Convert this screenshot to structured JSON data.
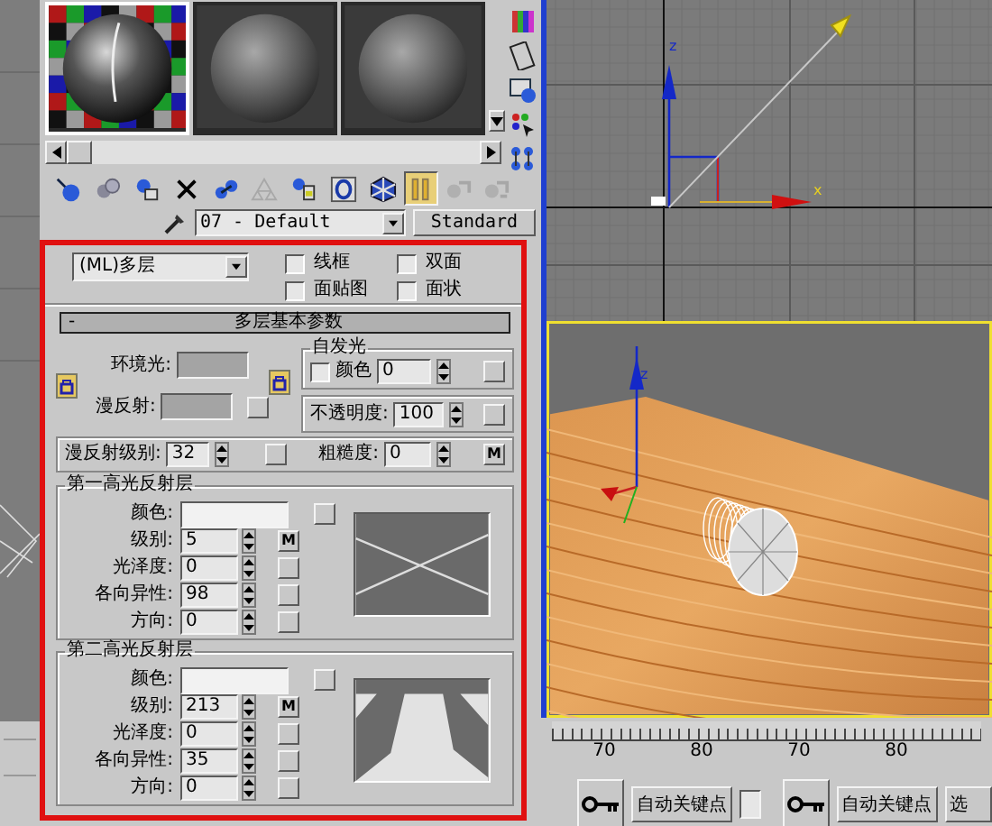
{
  "sample_slots": [
    {
      "selected": true,
      "checker_background": true
    },
    {
      "selected": false,
      "checker_background": false
    },
    {
      "selected": false,
      "checker_background": false
    }
  ],
  "toolbar_buttons": [
    {
      "pressed": false,
      "disabled": false
    },
    {
      "pressed": false,
      "disabled": false
    },
    {
      "pressed": false,
      "disabled": false
    },
    {
      "pressed": false,
      "disabled": false
    },
    {
      "pressed": false,
      "disabled": false
    },
    {
      "pressed": false,
      "disabled": true
    },
    {
      "pressed": false,
      "disabled": false
    },
    {
      "pressed": false,
      "disabled": false
    },
    {
      "pressed": false,
      "disabled": false
    },
    {
      "pressed": true,
      "disabled": false
    },
    {
      "pressed": false,
      "disabled": true
    },
    {
      "pressed": false,
      "disabled": true
    }
  ],
  "material_name": "07 - Default",
  "material_type": "Standard",
  "shader": "(ML)多层",
  "options": [
    {
      "label": "线框",
      "checked": false
    },
    {
      "label": "双面",
      "checked": false
    },
    {
      "label": "面贴图",
      "checked": false
    },
    {
      "label": "面状",
      "checked": false
    }
  ],
  "rollout": {
    "toggle": "-",
    "title": "多层基本参数"
  },
  "ambient_label": "环境光:",
  "diffuse_label": "漫反射:",
  "self_illum": {
    "title": "自发光",
    "color_label": "颜色",
    "color_checked": false,
    "value": "0"
  },
  "opacity": {
    "label": "不透明度:",
    "value": "100"
  },
  "diffuse_level": {
    "label": "漫反射级别:",
    "value": "32"
  },
  "roughness": {
    "label": "粗糙度:",
    "value": "0",
    "map_label": "M"
  },
  "specular_layers": [
    {
      "title": "第一高光反射层",
      "rows": [
        {
          "kind": "color",
          "label": "颜色:"
        },
        {
          "kind": "spinner",
          "label": "级别:",
          "value": "5",
          "map_label": "M"
        },
        {
          "kind": "spinner",
          "label": "光泽度:",
          "value": "0"
        },
        {
          "kind": "spinner",
          "label": "各向异性:",
          "value": "98"
        },
        {
          "kind": "spinner",
          "label": "方向:",
          "value": "0"
        }
      ]
    },
    {
      "title": "第二高光反射层",
      "rows": [
        {
          "kind": "color",
          "label": "颜色:"
        },
        {
          "kind": "spinner",
          "label": "级别:",
          "value": "213",
          "map_label": "M"
        },
        {
          "kind": "spinner",
          "label": "光泽度:",
          "value": "0"
        },
        {
          "kind": "spinner",
          "label": "各向异性:",
          "value": "35"
        },
        {
          "kind": "spinner",
          "label": "方向:",
          "value": "0"
        }
      ]
    }
  ],
  "top_viewport": {
    "axis_labels": [
      "z",
      "x"
    ]
  },
  "perspective_viewport": {
    "axis_label": "z"
  },
  "timeline": {
    "ticks": [
      "70",
      "80",
      "70",
      "80"
    ]
  },
  "key_buttons": [
    "自动关键点",
    "自动关键点"
  ],
  "select_button": "选"
}
